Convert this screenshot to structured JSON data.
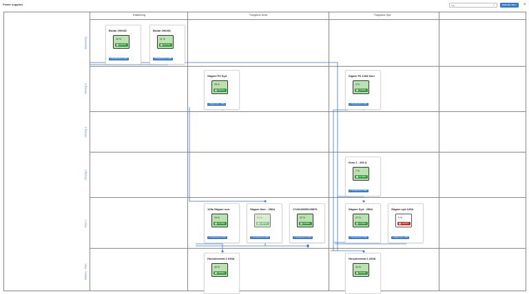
{
  "header": {
    "title": "Power supplies",
    "search_placeholder": "Sök...",
    "filter_label": "Switchar alla"
  },
  "columns": [
    "Etablering",
    "Trapphus Nord",
    "Trapphus Syd"
  ],
  "rows": [
    "Etablering",
    "Våning 4",
    "Våning 3",
    "Våning 2",
    "Plan 1",
    "Källare - Plan"
  ],
  "nodes": {
    "bod1": {
      "title": "Bodar 290462",
      "pct": "19 %",
      "id": "100276",
      "feed": "Huvudcentral 1 630A"
    },
    "bod2": {
      "title": "Bodar 290461",
      "pct": "11 %",
      "id": "121746",
      "feed": "Huvudcentral 1 630A"
    },
    "p6syd": {
      "title": "Stigare P6 Syd",
      "pct": "28 %",
      "id": "168769",
      "feed": "Stigare Norr - 250A"
    },
    "p6norr": {
      "title": "Sigare P6 125A Norr",
      "pct": "4 %",
      "id": "176026",
      "feed": "Huvudcentral 1 630A"
    },
    "kran": {
      "title": "Kran 2 - 250 A",
      "pct": "7 %",
      "id": "147059",
      "feed": "Huvudcentral 1 630A"
    },
    "stnorr125": {
      "title": "125a Stigare norr",
      "pct": "29 %",
      "id": "157098",
      "feed": "Huvudcentral 2 630A"
    },
    "stnorr250": {
      "title": "Stigare Norr - 250A",
      "pct": "24 %",
      "id": "168676",
      "feed": "Huvudcentral 1 630A"
    },
    "id17": {
      "title": "17e5128605145876",
      "pct": "22 %",
      "id": "166850",
      "feed": "Huvudcentral 1 630A"
    },
    "stsyd250": {
      "title": "Stigare Syd - 250A",
      "pct": "47 %",
      "id": "173950",
      "feed": "Huvudcentral 1 630A"
    },
    "stsyd125": {
      "title": "Stigare syd 125A",
      "pct": "0 %",
      "id": "132975",
      "feed": "Stigare Syd - 250A"
    },
    "hc2": {
      "title": "Huvudcentral 2 630A",
      "pct": "49 %",
      "id": "193533"
    },
    "hc1": {
      "title": "Huvudcentral 1 630A",
      "pct": "34 %",
      "id": "193493"
    }
  },
  "colors": {
    "accent": "#3a78c9",
    "ok": "#2d9d3a",
    "alert": "#e0241b",
    "meter": "#b9e2b0"
  }
}
